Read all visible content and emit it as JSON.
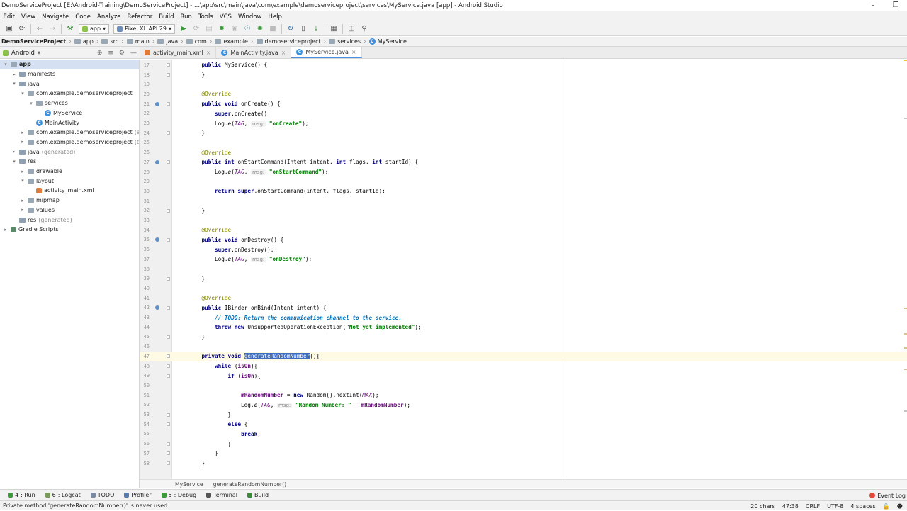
{
  "window": {
    "title": "DemoServiceProject [E:\\Android-Training\\DemoServiceProject] - ...\\app\\src\\main\\java\\com\\example\\demoserviceproject\\services\\MyService.java [app] - Android Studio"
  },
  "menu": [
    "Edit",
    "View",
    "Navigate",
    "Code",
    "Analyze",
    "Refactor",
    "Build",
    "Run",
    "Tools",
    "VCS",
    "Window",
    "Help"
  ],
  "toolbar": {
    "run_config": "app",
    "device": "Pixel XL API 29"
  },
  "breadcrumb": [
    "DemoServiceProject",
    "app",
    "src",
    "main",
    "java",
    "com",
    "example",
    "demoserviceproject",
    "services",
    "MyService"
  ],
  "project_panel": {
    "view": "Android",
    "tree": [
      {
        "label": "app",
        "depth": 0,
        "arrow": "▾",
        "icon": "folder",
        "bold": true,
        "selected": true
      },
      {
        "label": "manifests",
        "depth": 1,
        "arrow": "▸",
        "icon": "folder"
      },
      {
        "label": "java",
        "depth": 1,
        "arrow": "▾",
        "icon": "folder"
      },
      {
        "label": "com.example.demoserviceproject",
        "depth": 2,
        "arrow": "▾",
        "icon": "folder"
      },
      {
        "label": "services",
        "depth": 3,
        "arrow": "▾",
        "icon": "folder"
      },
      {
        "label": "MyService",
        "depth": 4,
        "arrow": "",
        "icon": "class"
      },
      {
        "label": "MainActivity",
        "depth": 3,
        "arrow": "",
        "icon": "class"
      },
      {
        "label": "com.example.demoserviceproject",
        "suffix": "(andro",
        "depth": 2,
        "arrow": "▸",
        "icon": "folder"
      },
      {
        "label": "com.example.demoserviceproject",
        "suffix": "(test)",
        "depth": 2,
        "arrow": "▸",
        "icon": "folder"
      },
      {
        "label": "java",
        "suffix": "(generated)",
        "depth": 1,
        "arrow": "▸",
        "icon": "folder"
      },
      {
        "label": "res",
        "depth": 1,
        "arrow": "▾",
        "icon": "folder"
      },
      {
        "label": "drawable",
        "depth": 2,
        "arrow": "▸",
        "icon": "folder"
      },
      {
        "label": "layout",
        "depth": 2,
        "arrow": "▾",
        "icon": "folder"
      },
      {
        "label": "activity_main.xml",
        "depth": 3,
        "arrow": "",
        "icon": "xml"
      },
      {
        "label": "mipmap",
        "depth": 2,
        "arrow": "▸",
        "icon": "folder"
      },
      {
        "label": "values",
        "depth": 2,
        "arrow": "▸",
        "icon": "folder"
      },
      {
        "label": "res",
        "suffix": "(generated)",
        "depth": 1,
        "arrow": "",
        "icon": "folder"
      },
      {
        "label": "Gradle Scripts",
        "depth": 0,
        "arrow": "▸",
        "icon": "gradle"
      }
    ]
  },
  "tabs": [
    {
      "label": "activity_main.xml",
      "active": false
    },
    {
      "label": "MainActivity.java",
      "active": false
    },
    {
      "label": "MyService.java",
      "active": true
    }
  ],
  "code_lines": [
    {
      "n": "17",
      "html": "    <span class=\"kw\">public</span> MyService() {"
    },
    {
      "n": "18",
      "html": "    }"
    },
    {
      "n": "19",
      "html": ""
    },
    {
      "n": "20",
      "html": "    <span class=\"an\">@Override</span>"
    },
    {
      "n": "21",
      "html": "    <span class=\"kw\">public void</span> onCreate() {",
      "marker": true
    },
    {
      "n": "22",
      "html": "        <span class=\"kw\">super</span>.onCreate();"
    },
    {
      "n": "23",
      "html": "        Log.<i>e</i>(<span class=\"fn\">TAG</span>, <span class=\"hint\">msg:</span> <span class=\"st\">\"onCreate\"</span>);"
    },
    {
      "n": "24",
      "html": "    }"
    },
    {
      "n": "25",
      "html": ""
    },
    {
      "n": "26",
      "html": "    <span class=\"an\">@Override</span>"
    },
    {
      "n": "27",
      "html": "    <span class=\"kw\">public int</span> onStartCommand(Intent intent, <span class=\"kw\">int</span> flags, <span class=\"kw\">int</span> startId) {",
      "marker": true
    },
    {
      "n": "28",
      "html": "        Log.<i>e</i>(<span class=\"fn\">TAG</span>, <span class=\"hint\">msg:</span> <span class=\"st\">\"onStartCommand\"</span>);"
    },
    {
      "n": "29",
      "html": ""
    },
    {
      "n": "30",
      "html": "        <span class=\"kw\">return super</span>.onStartCommand(intent, flags, startId);"
    },
    {
      "n": "31",
      "html": ""
    },
    {
      "n": "32",
      "html": "    }"
    },
    {
      "n": "33",
      "html": ""
    },
    {
      "n": "34",
      "html": "    <span class=\"an\">@Override</span>"
    },
    {
      "n": "35",
      "html": "    <span class=\"kw\">public void</span> onDestroy() {",
      "marker": true
    },
    {
      "n": "36",
      "html": "        <span class=\"kw\">super</span>.onDestroy();"
    },
    {
      "n": "37",
      "html": "        Log.<i>e</i>(<span class=\"fn\">TAG</span>, <span class=\"hint\">msg:</span> <span class=\"st\">\"onDestroy\"</span>);"
    },
    {
      "n": "38",
      "html": ""
    },
    {
      "n": "39",
      "html": "    }"
    },
    {
      "n": "40",
      "html": ""
    },
    {
      "n": "41",
      "html": "    <span class=\"an\">@Override</span>"
    },
    {
      "n": "42",
      "html": "    <span class=\"kw\">public</span> IBinder onBind(Intent intent) {",
      "marker": true
    },
    {
      "n": "43",
      "html": "        <span class=\"todo\">// TODO: Return the communication channel to the service.</span>"
    },
    {
      "n": "44",
      "html": "        <span class=\"kw\">throw new</span> UnsupportedOperationException(<span class=\"st\">\"Not yet implemented\"</span>);"
    },
    {
      "n": "45",
      "html": "    }"
    },
    {
      "n": "46",
      "html": ""
    },
    {
      "n": "47",
      "html": "    <span class=\"kw\">private void</span> <span class=\"hl\">generateRandomNumber</span>(){",
      "current": true
    },
    {
      "n": "48",
      "html": "        <span class=\"kw\">while</span> (<span class=\"fld\">isOn</span>){"
    },
    {
      "n": "49",
      "html": "            <span class=\"kw\">if</span> (<span class=\"fld\">isOn</span>){"
    },
    {
      "n": "50",
      "html": ""
    },
    {
      "n": "51",
      "html": "                <span class=\"fld\">mRandomNumber</span> = <span class=\"kw\">new</span> Random().nextInt(<span class=\"fn\">MAX</span>);"
    },
    {
      "n": "52",
      "html": "                Log.<i>e</i>(<span class=\"fn\">TAG</span>, <span class=\"hint\">msg:</span> <span class=\"st\">\"Random Number: \"</span> + <span class=\"fld\">mRandomNumber</span>);"
    },
    {
      "n": "53",
      "html": "            }"
    },
    {
      "n": "54",
      "html": "            <span class=\"kw\">else</span> {"
    },
    {
      "n": "55",
      "html": "                <span class=\"kw\">break</span>;"
    },
    {
      "n": "56",
      "html": "            }"
    },
    {
      "n": "57",
      "html": "        }"
    },
    {
      "n": "58",
      "html": "    }"
    }
  ],
  "code_breadcrumb": [
    "MyService",
    "generateRandomNumber()"
  ],
  "bottom_tabs": [
    {
      "key": "4",
      "label": ": Run",
      "icon": "run-icon"
    },
    {
      "key": "6",
      "label": ": Logcat",
      "icon": "logcat-icon"
    },
    {
      "key": "",
      "label": "TODO",
      "icon": "todo-icon"
    },
    {
      "key": "",
      "label": "Profiler",
      "icon": "profiler-icon"
    },
    {
      "key": "5",
      "label": ": Debug",
      "icon": "debug-icon"
    },
    {
      "key": "",
      "label": "Terminal",
      "icon": "terminal-icon"
    },
    {
      "key": "",
      "label": "Build",
      "icon": "build-icon"
    }
  ],
  "event_log": "Event Log",
  "status": {
    "message": "Private method 'generateRandomNumber()' is never used",
    "chars": "20 chars",
    "position": "47:38",
    "line_sep": "CRLF",
    "encoding": "UTF-8",
    "indent": "4 spaces"
  }
}
